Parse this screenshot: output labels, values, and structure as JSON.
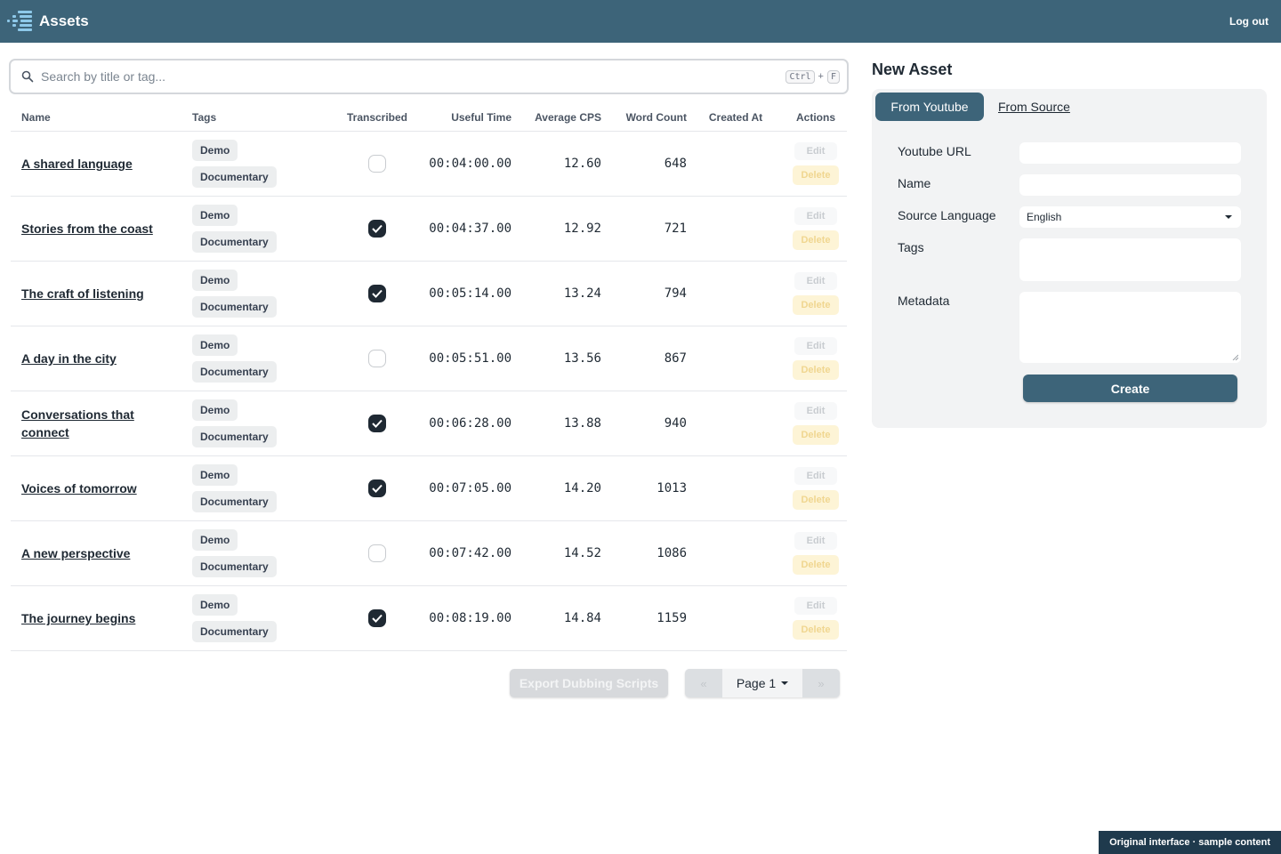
{
  "header": {
    "title": "Assets",
    "logout_label": "Log out",
    "logo_icon": "sound-wave-logo-icon"
  },
  "search": {
    "placeholder": "Search by title or tag...",
    "shortcut_key1": "Ctrl",
    "shortcut_plus": "+",
    "shortcut_key2": "F"
  },
  "table": {
    "columns": [
      "Name",
      "Tags",
      "Transcribed",
      "Useful Time",
      "Average CPS",
      "Word Count",
      "Created At",
      "Actions"
    ],
    "edit_label": "Edit",
    "delete_label": "Delete",
    "rows": [
      {
        "name": "A shared language",
        "tags": [
          "Demo",
          "Documentary"
        ],
        "transcribed": false,
        "useful_time": "00:04:00.00",
        "avg_cps": "12.60",
        "word_count": "648",
        "created_at": ""
      },
      {
        "name": "Stories from the coast",
        "tags": [
          "Demo",
          "Documentary"
        ],
        "transcribed": true,
        "useful_time": "00:04:37.00",
        "avg_cps": "12.92",
        "word_count": "721",
        "created_at": ""
      },
      {
        "name": "The craft of listening",
        "tags": [
          "Demo",
          "Documentary"
        ],
        "transcribed": true,
        "useful_time": "00:05:14.00",
        "avg_cps": "13.24",
        "word_count": "794",
        "created_at": ""
      },
      {
        "name": "A day in the city",
        "tags": [
          "Demo",
          "Documentary"
        ],
        "transcribed": false,
        "useful_time": "00:05:51.00",
        "avg_cps": "13.56",
        "word_count": "867",
        "created_at": ""
      },
      {
        "name": "Conversations that connect",
        "tags": [
          "Demo",
          "Documentary"
        ],
        "transcribed": true,
        "useful_time": "00:06:28.00",
        "avg_cps": "13.88",
        "word_count": "940",
        "created_at": ""
      },
      {
        "name": "Voices of tomorrow",
        "tags": [
          "Demo",
          "Documentary"
        ],
        "transcribed": true,
        "useful_time": "00:07:05.00",
        "avg_cps": "14.20",
        "word_count": "1013",
        "created_at": ""
      },
      {
        "name": "A new perspective",
        "tags": [
          "Demo",
          "Documentary"
        ],
        "transcribed": false,
        "useful_time": "00:07:42.00",
        "avg_cps": "14.52",
        "word_count": "1086",
        "created_at": ""
      },
      {
        "name": "The journey begins",
        "tags": [
          "Demo",
          "Documentary"
        ],
        "transcribed": true,
        "useful_time": "00:08:19.00",
        "avg_cps": "14.84",
        "word_count": "1159",
        "created_at": ""
      }
    ]
  },
  "toolbar": {
    "export_label": "Export Dubbing Scripts",
    "prev_label": "«",
    "page_label": "Page 1",
    "next_label": "»"
  },
  "new_asset": {
    "title": "New Asset",
    "tab_active": "From Youtube",
    "tab_other": "From Source",
    "fields": {
      "youtube_url_label": "Youtube URL",
      "youtube_url_value": "",
      "name_label": "Name",
      "name_value": "",
      "source_language_label": "Source Language",
      "source_language_value": "English",
      "tags_label": "Tags",
      "tags_value": "",
      "metadata_label": "Metadata",
      "metadata_value": ""
    },
    "create_label": "Create"
  },
  "footer": {
    "badge": "Original interface · sample content"
  },
  "colors": {
    "header_bg": "#3d6479",
    "primary": "#3d6479",
    "delete_bg": "#fdf4d6",
    "checked": "#1f2933"
  }
}
